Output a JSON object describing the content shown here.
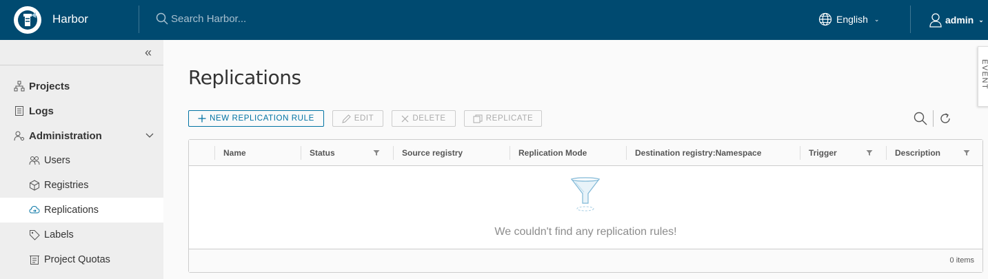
{
  "header": {
    "brand": "Harbor",
    "search_placeholder": "Search Harbor...",
    "language": "English",
    "user": "admin"
  },
  "sidebar": {
    "items": [
      {
        "label": "Projects",
        "icon": "projects-icon"
      },
      {
        "label": "Logs",
        "icon": "logs-icon"
      },
      {
        "label": "Administration",
        "icon": "administration-icon"
      },
      {
        "label": "Users",
        "icon": "users-icon"
      },
      {
        "label": "Registries",
        "icon": "registries-icon"
      },
      {
        "label": "Replications",
        "icon": "replications-icon",
        "active": true
      },
      {
        "label": "Labels",
        "icon": "labels-icon"
      },
      {
        "label": "Project Quotas",
        "icon": "project-quotas-icon"
      }
    ]
  },
  "main": {
    "title": "Replications",
    "toolbar": {
      "new_rule": "NEW REPLICATION RULE",
      "edit": "EDIT",
      "delete": "DELETE",
      "replicate": "REPLICATE"
    },
    "table": {
      "columns": [
        "Name",
        "Status",
        "Source registry",
        "Replication Mode",
        "Destination registry:Namespace",
        "Trigger",
        "Description"
      ],
      "empty_message": "We couldn't find any replication rules!",
      "count": "0 items"
    },
    "event_tab": "EVENT"
  },
  "colors": {
    "header_bg": "#004a70",
    "accent": "#0072a3",
    "sidebar_bg": "#eeeeee"
  }
}
